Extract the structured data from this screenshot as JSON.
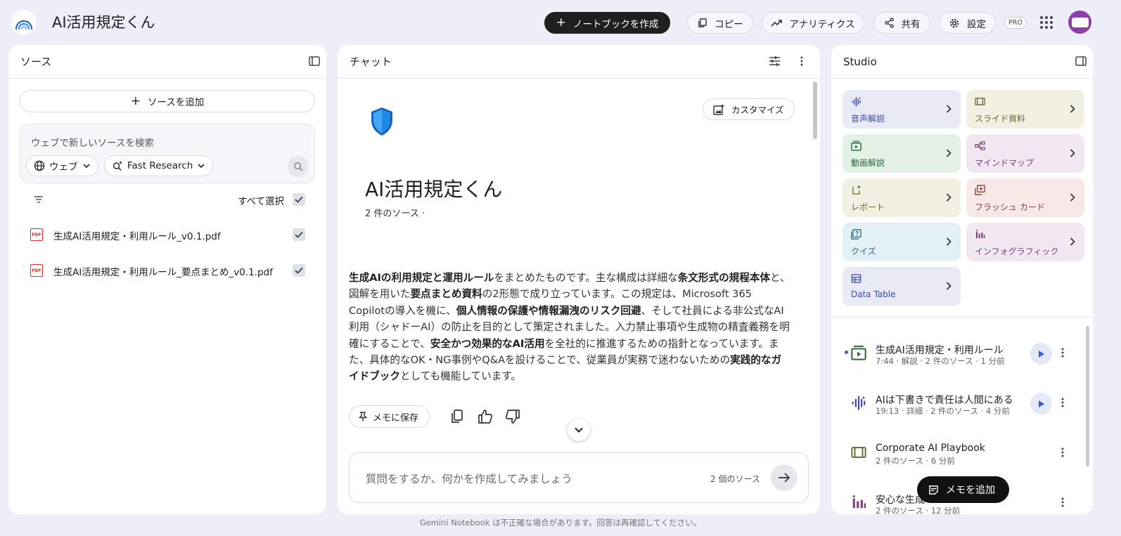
{
  "header": {
    "title": "AI活用規定くん",
    "create_notebook": "ノートブックを作成",
    "copy": "コピー",
    "analytics": "アナリティクス",
    "share": "共有",
    "settings": "設定",
    "pro": "PRO"
  },
  "sources": {
    "title": "ソース",
    "add_source": "ソースを追加",
    "search_placeholder": "ウェブで新しいソースを検索",
    "web_chip": "ウェブ",
    "research_chip": "Fast Research",
    "select_all": "すべて選択",
    "items": [
      {
        "name": "生成AI活用規定・利用ルール_v0.1.pdf",
        "checked": true
      },
      {
        "name": "生成AI活用規定・利用ルール_要点まとめ_v0.1.pdf",
        "checked": true
      }
    ]
  },
  "chat": {
    "title": "チャット",
    "customize": "カスタマイズ",
    "notebook_title": "AI活用規定くん",
    "source_count": "2 件のソース ·",
    "summary": [
      {
        "t": "生成AIの利用規定と運用ルール",
        "b": true
      },
      {
        "t": "をまとめたものです。主な構成は詳細な",
        "b": false
      },
      {
        "t": "条文形式の規程本体",
        "b": true
      },
      {
        "t": "と、図解を用いた",
        "b": false
      },
      {
        "t": "要点まとめ資料",
        "b": true
      },
      {
        "t": "の2形態で成り立っています。この規定は、Microsoft 365 Copilotの導入を機に、",
        "b": false
      },
      {
        "t": "個人情報の保護や情報漏洩のリスク回避",
        "b": true
      },
      {
        "t": "、そして社員による非公式なAI利用（シャドーAI）の防止を目的として策定されました。入力禁止事項や生成物の精査義務を明確にすることで、",
        "b": false
      },
      {
        "t": "安全かつ効果的なAI活用",
        "b": true
      },
      {
        "t": "を全社的に推進するための指針となっています。また、具体的なOK・NG事例やQ&Aを設けることで、従業員が実務で迷わないための",
        "b": false
      },
      {
        "t": "実践的なガイドブック",
        "b": true
      },
      {
        "t": "としても機能しています。",
        "b": false
      }
    ],
    "save_memo": "メモに保存",
    "input_placeholder": "質問をするか、何かを作成してみましょう",
    "input_source_count": "2 個のソース"
  },
  "studio": {
    "title": "Studio",
    "tiles": [
      {
        "label": "音声解説",
        "icon": "audio-wave-icon",
        "bg": "#e8eaf6",
        "fg": "#3f4aa8"
      },
      {
        "label": "スライド資料",
        "icon": "slides-icon",
        "bg": "#f1f0e3",
        "fg": "#6b6a3a"
      },
      {
        "label": "動画解説",
        "icon": "video-icon",
        "bg": "#e3f1e6",
        "fg": "#2e6b3e"
      },
      {
        "label": "マインドマップ",
        "icon": "mindmap-icon",
        "bg": "#f2e8f2",
        "fg": "#7a3f7a"
      },
      {
        "label": "レポート",
        "icon": "report-icon",
        "bg": "#f1f0e3",
        "fg": "#6b6a3a"
      },
      {
        "label": "フラッシュ カード",
        "icon": "flashcard-icon",
        "bg": "#f7e9e8",
        "fg": "#8c3b35"
      },
      {
        "label": "クイズ",
        "icon": "quiz-icon",
        "bg": "#e2f1f6",
        "fg": "#2d6577"
      },
      {
        "label": "インフォグラフィック",
        "icon": "infographic-icon",
        "bg": "#f2e8f2",
        "fg": "#7a3f7a"
      },
      {
        "label": "Data Table",
        "icon": "table-icon",
        "bg": "#e8eaf6",
        "fg": "#3f4aa8"
      }
    ],
    "generated": [
      {
        "title": "生成AI活用規定・利用ルール",
        "meta": "7:44 · 解説 · 2 件のソース · 1 分前",
        "icon": "video-icon",
        "playable": true,
        "new": true
      },
      {
        "title": "AIは下書きで責任は人間にある",
        "meta": "19:13 · 詳細 · 2 件のソース · 4 分前",
        "icon": "audio-wave-icon",
        "playable": true,
        "new": false
      },
      {
        "title": "Corporate AI Playbook",
        "meta": "2 件のソース · 6 分前",
        "icon": "slides-icon",
        "playable": false,
        "new": false
      },
      {
        "title": "安心な生成",
        "meta": "2 件のソース · 12 分前",
        "icon": "infographic-icon",
        "playable": false,
        "new": false
      }
    ],
    "add_memo": "メモを追加"
  },
  "footer": "Gemini Notebook は不正確な場合があります。回答は再確認してください。"
}
